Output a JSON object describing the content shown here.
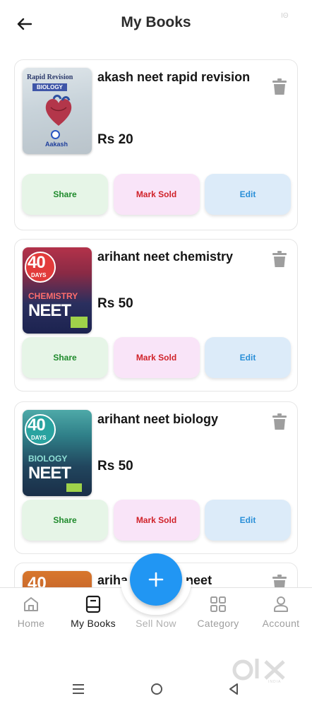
{
  "header": {
    "title": "My Books",
    "back_icon": "arrow-left-icon",
    "status_mark": "ΙΘ"
  },
  "books": [
    {
      "title": "akash neet rapid revision",
      "price": "Rs 20",
      "cover": {
        "top_text": "Rapid Revision",
        "band_text": "BIOLOGY",
        "brand": "Aakash"
      },
      "actions": {
        "share": "Share",
        "mark_sold": "Mark Sold",
        "edit": "Edit"
      }
    },
    {
      "title": "arihant neet chemistry",
      "price": "Rs 50",
      "cover": {
        "number": "40",
        "days": "DAYS",
        "subject": "CHEMISTRY",
        "exam": "NEET"
      },
      "actions": {
        "share": "Share",
        "mark_sold": "Mark Sold",
        "edit": "Edit"
      }
    },
    {
      "title": "arihant neet biology",
      "price": "Rs 50",
      "cover": {
        "number": "40",
        "days": "DAYS",
        "subject": "BIOLOGY",
        "exam": "NEET"
      },
      "actions": {
        "share": "Share",
        "mark_sold": "Mark Sold",
        "edit": "Edit"
      }
    },
    {
      "title": "arihant physics neet",
      "visible_title": "ariha",
      "visible_title_tail": "cs neet",
      "cover": {
        "number": "40"
      }
    }
  ],
  "fab": {
    "icon": "plus-icon"
  },
  "bottom_nav": [
    {
      "label": "Home",
      "icon": "home-icon",
      "active": false
    },
    {
      "label": "My Books",
      "icon": "book-icon",
      "active": true
    },
    {
      "label": "Sell Now",
      "icon": "plus-icon",
      "active": false
    },
    {
      "label": "Category",
      "icon": "grid-icon",
      "active": false
    },
    {
      "label": "Account",
      "icon": "user-icon",
      "active": false
    }
  ],
  "watermark": {
    "brand": "olx",
    "tag": "INDIA"
  },
  "colors": {
    "accent": "#2196f3",
    "share": "#1f8a2c",
    "mark_sold": "#d0222a",
    "edit": "#2a8fd8",
    "share_bg": "#e6f5e7",
    "mark_sold_bg": "#f9e4f8",
    "edit_bg": "#dcebf9"
  }
}
